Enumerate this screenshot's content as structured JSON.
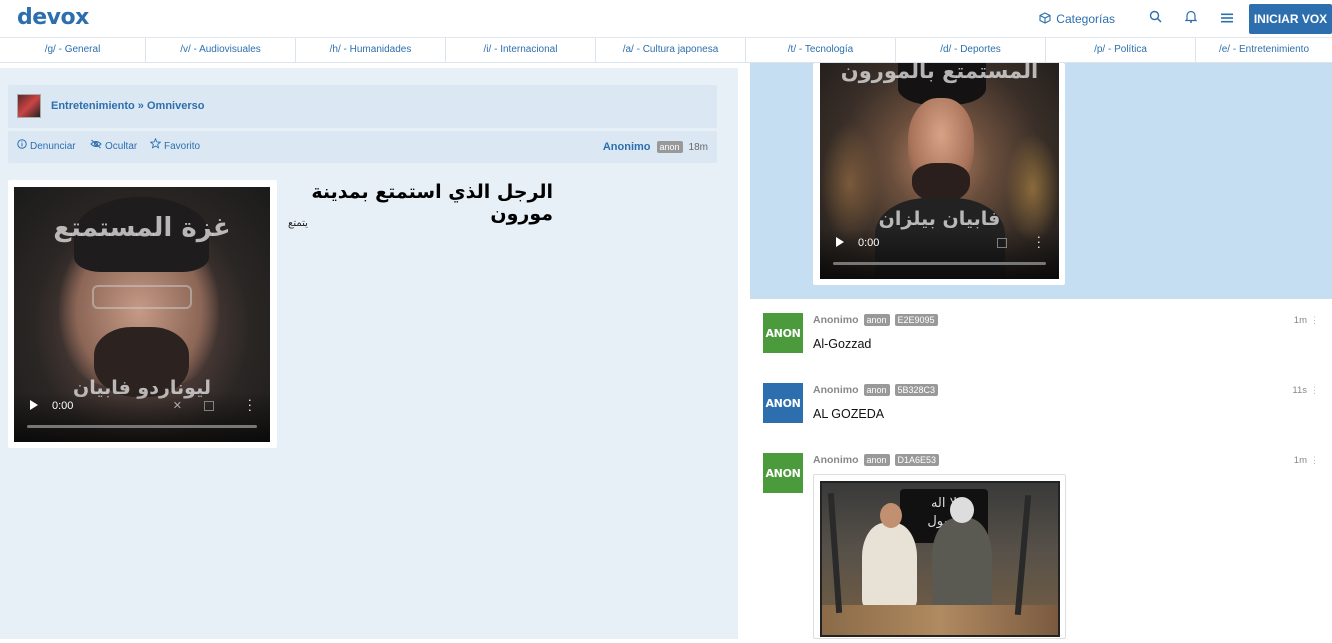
{
  "header": {
    "logo": "devox",
    "categories_label": "Categorías",
    "login_label": "INICIAR VOX",
    "icons": [
      "cube-icon",
      "search-icon",
      "bell-icon",
      "menu-icon"
    ]
  },
  "boards": [
    "/g/ - General",
    "/v/ - Audiovisuales",
    "/h/ - Humanidades",
    "/i/ - Internacional",
    "/a/ - Cultura japonesa",
    "/t/ - Tecnología",
    "/d/ - Deportes",
    "/p/ - Política",
    "/e/ - Entretenimiento"
  ],
  "thread": {
    "breadcrumb_category": "Entretenimiento",
    "breadcrumb_separator": "»",
    "breadcrumb_board": "Omniverso",
    "actions": {
      "report": "Denunciar",
      "hide": "Ocultar",
      "favorite": "Favorito"
    },
    "author": "Anonimo",
    "author_badge": "anon",
    "time": "18m",
    "title": "الرجل الذي استمتع بمدينة مورون",
    "body": "يتمتع",
    "video": {
      "overlay_top": "غزة المستمتع",
      "overlay_bottom": "ليوناردو فابيان",
      "time": "0:00"
    }
  },
  "highlight_video": {
    "overlay_top": "المستمتع بالمورون",
    "overlay_bottom": "فابيان بيلزان",
    "time": "0:00"
  },
  "replies": [
    {
      "name": "Anonimo",
      "badge": "anon",
      "id": "E2E9095",
      "time": "1m",
      "text": "Al-Gozzad",
      "avatar": "ANON",
      "avatar_color": "#4b9a3c"
    },
    {
      "name": "Anonimo",
      "badge": "anon",
      "id": "5B328C3",
      "time": "11s",
      "text": "AL GOZEDA",
      "avatar": "ANON",
      "avatar_color": "#2d6fae"
    },
    {
      "name": "Anonimo",
      "badge": "anon",
      "id": "D1A6E53",
      "time": "1m",
      "text": "",
      "avatar": "ANON",
      "avatar_color": "#4b9a3c",
      "image_flag_text": "لا اله\nرسول"
    }
  ],
  "colors": {
    "accent": "#2d6fae",
    "left_bg": "#e8f0f7",
    "highlight_bg": "#c5def1"
  }
}
